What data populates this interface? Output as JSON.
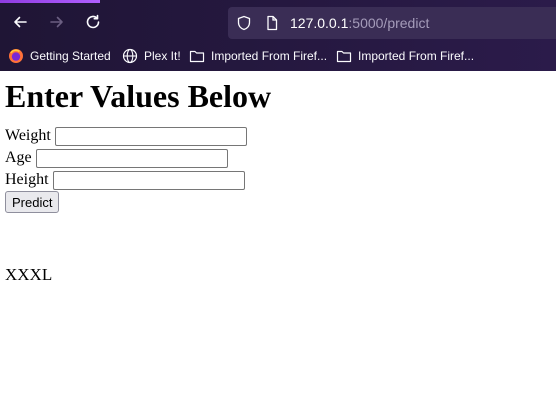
{
  "browser": {
    "url_host": "127.0.0.1",
    "url_path": ":5000/predict",
    "bookmarks": [
      {
        "label": "Getting Started",
        "icon": "firefox-icon"
      },
      {
        "label": "Plex It!",
        "icon": "globe-icon"
      },
      {
        "label": "Imported From Firef...",
        "icon": "folder-icon"
      },
      {
        "label": "Imported From Firef...",
        "icon": "folder-icon"
      }
    ]
  },
  "page": {
    "heading": "Enter Values Below",
    "fields": [
      {
        "label": "Weight",
        "value": ""
      },
      {
        "label": "Age",
        "value": ""
      },
      {
        "label": "Height",
        "value": ""
      }
    ],
    "submit_label": "Predict",
    "result": "XXXL"
  }
}
